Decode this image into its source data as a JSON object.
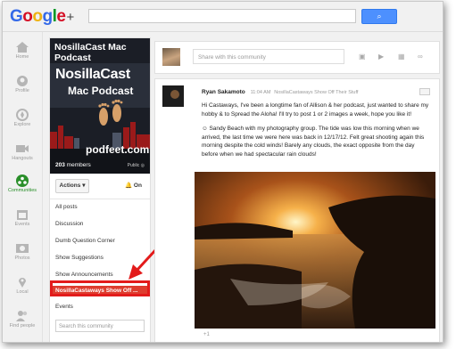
{
  "logo": {
    "g": "G",
    "o1": "o",
    "o2": "o",
    "g2": "g",
    "l": "l",
    "e": "e",
    "plus": "+"
  },
  "search": {
    "button_label": "⌕"
  },
  "nav": [
    {
      "label": "Home",
      "icon": "home-icon"
    },
    {
      "label": "Profile",
      "icon": "profile-icon"
    },
    {
      "label": "Explore",
      "icon": "compass-icon"
    },
    {
      "label": "Hangouts",
      "icon": "camera-icon"
    },
    {
      "label": "Communities",
      "icon": "communities-icon"
    },
    {
      "label": "Events",
      "icon": "calendar-icon"
    },
    {
      "label": "Photos",
      "icon": "photos-icon"
    },
    {
      "label": "Local",
      "icon": "map-pin-icon"
    },
    {
      "label": "Find people",
      "icon": "people-icon"
    }
  ],
  "community": {
    "title": "NosillaCast Mac Podcast",
    "cover_big": "NosillaCast",
    "cover_sub": "Mac Podcast",
    "cover_site": "podfeet.com",
    "members_count": "203",
    "members_label": "members",
    "public_label": "Public",
    "actions_label": "Actions",
    "notif_label": "On",
    "categories": [
      "All posts",
      "Discussion",
      "Dumb Question Corner",
      "Show Suggestions",
      "Show Announcements",
      "NosillaCastaways Show Off ...",
      "Events"
    ],
    "selected_index": 5,
    "find_placeholder": "Search this community"
  },
  "share": {
    "placeholder": "Share with this community"
  },
  "post": {
    "author": "Ryan Sakamoto",
    "time": "11:04 AM",
    "category": "NosillaCastaways Show Off Their Stuff",
    "paragraph1": "Hi Castaways, I've been a longtime fan of Allison & her podcast, just wanted to share my hobby & to Spread the Aloha! I'll try to post 1 or 2 images a week, hope you like it!",
    "paragraph2": "☺ Sandy Beach with my photography group. The tide was low this morning when we arrived, the last time we were here was back in 12/17/12. Felt great shooting again this morning despite the cold winds! Barely any clouds, the exact opposite from the day before when we had spectacular rain clouds!",
    "plus_one": "+1"
  },
  "colors": {
    "highlight": "#de3d2f",
    "annotation": "#e31b1b",
    "google_blue": "#4d90fe",
    "communities_green": "#2a8f2a"
  }
}
